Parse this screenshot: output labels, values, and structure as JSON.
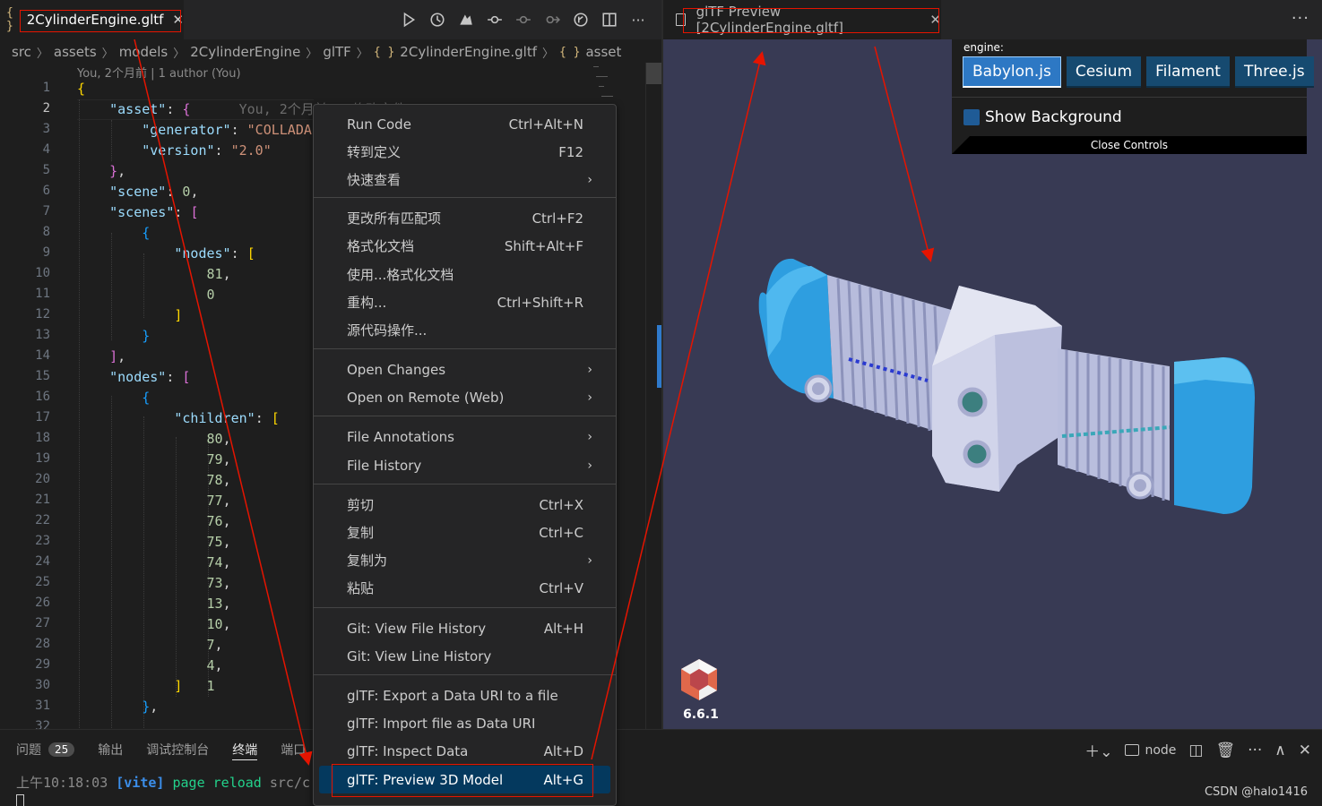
{
  "editor": {
    "tab": {
      "icon": "{ }",
      "name": "2CylinderEngine.gltf",
      "close": "✕"
    },
    "breadcrumb": [
      "src",
      "assets",
      "models",
      "2CylinderEngine",
      "glTF",
      "2CylinderEngine.gltf",
      "asset"
    ],
    "breadcrumb_brace": "{ }",
    "blame": "You, 2个月前 | 1 author (You)",
    "inline_blame": "You, 2个月前 • 修改文件",
    "line_numbers": [
      "1",
      "2",
      "3",
      "4",
      "5",
      "6",
      "7",
      "8",
      "9",
      "10",
      "11",
      "12",
      "13",
      "14",
      "15",
      "16",
      "17",
      "18",
      "19",
      "20",
      "21",
      "22",
      "23",
      "24",
      "25",
      "26",
      "27",
      "28",
      "29",
      "30",
      "31",
      "32"
    ],
    "code": {
      "asset_key": "\"asset\"",
      "generator_key": "\"generator\"",
      "generator_val": "\"COLLADA",
      "version_key": "\"version\"",
      "version_val": "\"2.0\"",
      "scene_key": "\"scene\"",
      "scene_val": "0",
      "scenes_key": "\"scenes\"",
      "nodes_key": "\"nodes\"",
      "nodes_vals": [
        "81",
        "0"
      ],
      "children_key": "\"children\"",
      "children_vals": [
        "80",
        "79",
        "78",
        "77",
        "76",
        "75",
        "74",
        "73",
        "13",
        "10",
        "7",
        "4",
        "1"
      ]
    }
  },
  "context_menu": {
    "items": [
      {
        "label": "Run Code",
        "shortcut": "Ctrl+Alt+N"
      },
      {
        "label": "转到定义",
        "shortcut": "F12"
      },
      {
        "label": "快速查看",
        "submenu": "›"
      },
      {
        "label": "更改所有匹配项",
        "shortcut": "Ctrl+F2"
      },
      {
        "label": "格式化文档",
        "shortcut": "Shift+Alt+F"
      },
      {
        "label": "使用...格式化文档"
      },
      {
        "label": "重构...",
        "shortcut": "Ctrl+Shift+R"
      },
      {
        "label": "源代码操作..."
      },
      {
        "label": "Open Changes",
        "submenu": "›"
      },
      {
        "label": "Open on Remote (Web)",
        "submenu": "›"
      },
      {
        "label": "File Annotations",
        "submenu": "›"
      },
      {
        "label": "File History",
        "submenu": "›"
      },
      {
        "label": "剪切",
        "shortcut": "Ctrl+X"
      },
      {
        "label": "复制",
        "shortcut": "Ctrl+C"
      },
      {
        "label": "复制为",
        "submenu": "›"
      },
      {
        "label": "粘贴",
        "shortcut": "Ctrl+V"
      },
      {
        "label": "Git: View File History",
        "shortcut": "Alt+H"
      },
      {
        "label": "Git: View Line History"
      },
      {
        "label": "glTF: Export a Data URI to a file"
      },
      {
        "label": "glTF: Import file as Data URI"
      },
      {
        "label": "glTF: Inspect Data",
        "shortcut": "Alt+D"
      },
      {
        "label": "glTF: Preview 3D Model",
        "shortcut": "Alt+G"
      }
    ]
  },
  "preview": {
    "tab_name": "glTF Preview [2CylinderEngine.gltf]",
    "tab_close": "✕",
    "more": "···",
    "engine_label": "engine:",
    "engines": [
      "Babylon.js",
      "Cesium",
      "Filament",
      "Three.js"
    ],
    "active_engine": "Babylon.js",
    "show_background": "Show Background",
    "close_controls": "Close Controls",
    "babylon_version": "6.6.1",
    "colors": {
      "viewport_bg": "#383a54",
      "engine_blue": "#2e9ee0",
      "engine_body": "#c9cde8"
    }
  },
  "panel": {
    "tabs": [
      "问题",
      "输出",
      "调试控制台",
      "终端",
      "端口"
    ],
    "problems_count": "25",
    "active_tab": "终端",
    "terminal_time": "上午10:18:03",
    "terminal_tag": "[vite]",
    "terminal_msg": "page reload",
    "terminal_path": "src/c",
    "shell": "node",
    "watermark": "CSDN @halo1416"
  }
}
